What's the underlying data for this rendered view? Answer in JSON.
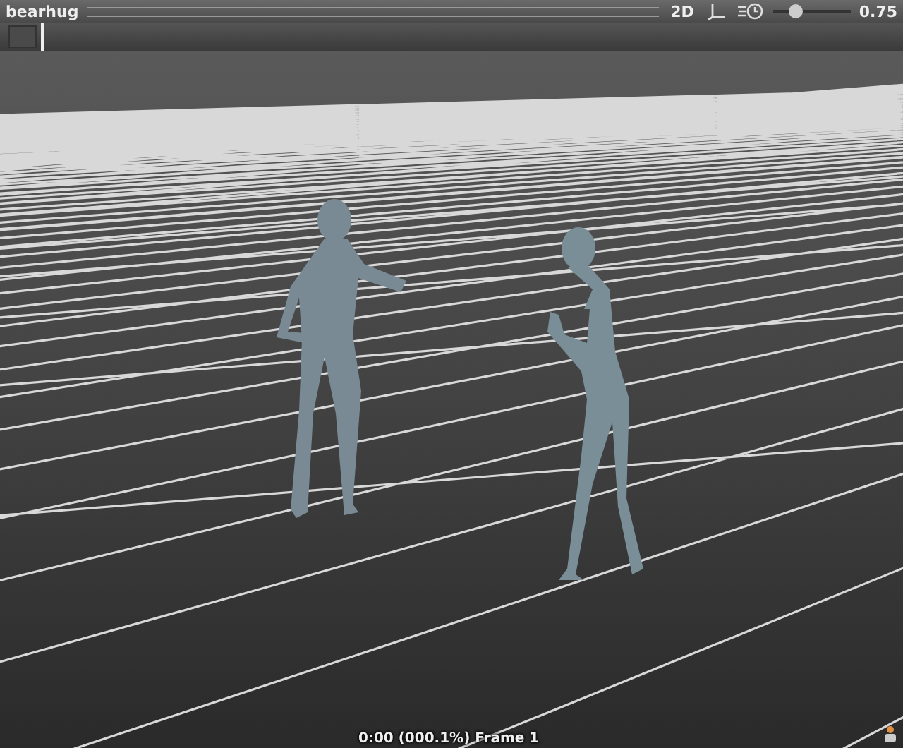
{
  "window": {
    "title": "bearhug"
  },
  "toolbar": {
    "mode_button": "2D",
    "speed_slider": {
      "level": 0.3
    },
    "speed_value": "0.75"
  },
  "timeline": {
    "level": 0.001
  },
  "status_bar": {
    "text": "0:00 (000.1%) Frame 1"
  }
}
